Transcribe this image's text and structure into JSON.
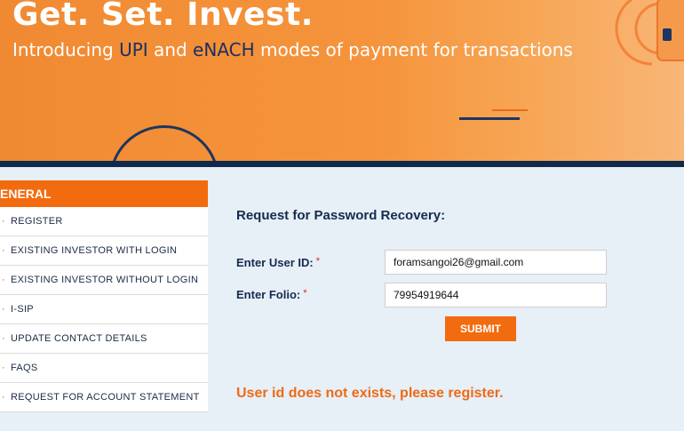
{
  "banner": {
    "title": "Get. Set. Invest.",
    "subtitle_pre": "Introducing ",
    "subtitle_upi": "UPI",
    "subtitle_mid": " and ",
    "subtitle_enach": "eNACH",
    "subtitle_post": " modes of payment for transactions"
  },
  "sidebar": {
    "header": "ENERAL",
    "items": [
      {
        "label": "REGISTER"
      },
      {
        "label": "EXISTING INVESTOR WITH LOGIN"
      },
      {
        "label": "EXISTING INVESTOR WITHOUT LOGIN"
      },
      {
        "label": "I-SIP"
      },
      {
        "label": "UPDATE CONTACT DETAILS"
      },
      {
        "label": "FAQS"
      },
      {
        "label": "REQUEST FOR ACCOUNT STATEMENT"
      }
    ]
  },
  "form": {
    "title": "Request for Password Recovery:",
    "user_id_label": "Enter User ID:",
    "user_id_value": "foramsangoi26@gmail.com",
    "folio_label": "Enter Folio:",
    "folio_value": "79954919644",
    "required_mark": "*",
    "submit_label": "SUBMIT"
  },
  "message": {
    "error": "User id does not exists, please register."
  },
  "colors": {
    "accent": "#f26b0f",
    "navy": "#152c4e",
    "error": "#ef6a16"
  }
}
